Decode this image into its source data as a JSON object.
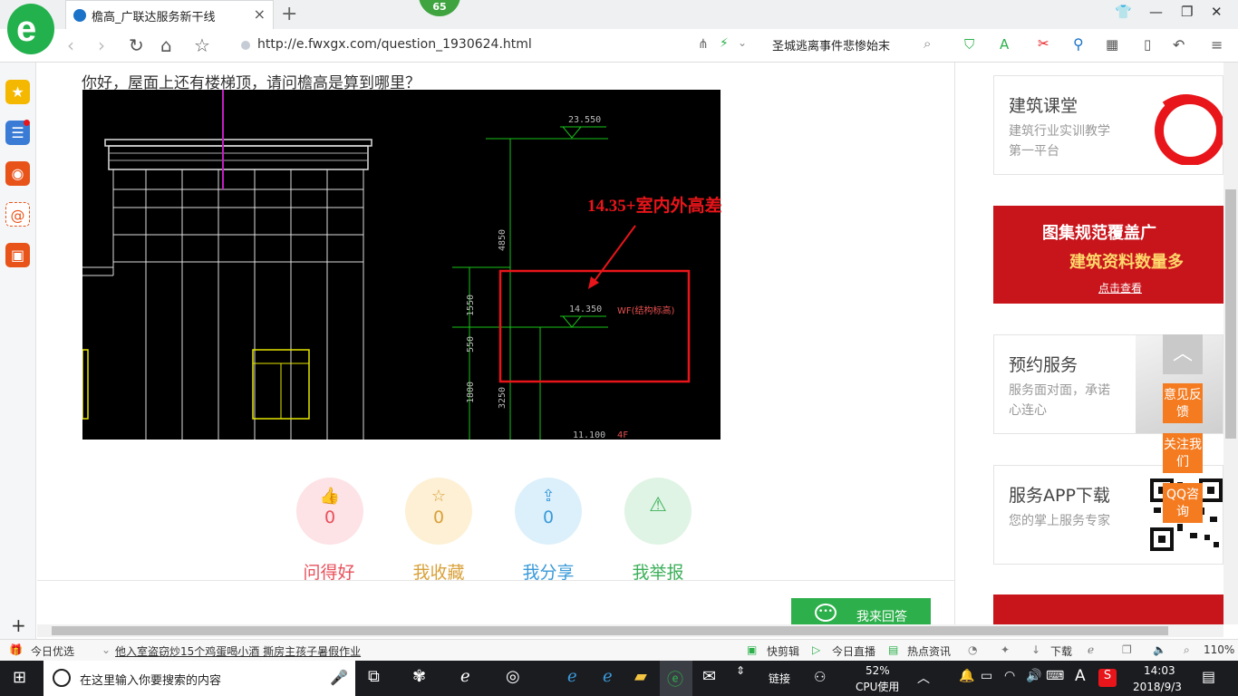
{
  "browser": {
    "tab_title": "檐高_广联达服务新干线",
    "badge_count": "65",
    "url": "http://e.fwxgx.com/question_1930624.html",
    "search_suggestion": "圣城逃离事件悲惨始末"
  },
  "question": {
    "text": "你好，屋面上还有楼梯顶，请问檐高是算到哪里？",
    "annotation": "14.35+室内外高差",
    "cad_labels": {
      "elev_top": "23.550",
      "elev_mid": "14.350",
      "elev_bottom": "11.100",
      "dim_4850": "4850",
      "dim_1550": "1550",
      "dim_550": "550",
      "dim_1800": "1800",
      "dim_3250": "3250",
      "wf_label": "WF(结构标高)",
      "floor_label": "4F"
    }
  },
  "actions": [
    {
      "label": "问得好",
      "count": "0",
      "icon": "thumbs-up-icon",
      "bg": "#fde2e6",
      "color": "#e8505b"
    },
    {
      "label": "我收藏",
      "count": "0",
      "icon": "star-icon",
      "bg": "#fdf0d4",
      "color": "#d9a13a"
    },
    {
      "label": "我分享",
      "count": "0",
      "icon": "share-icon",
      "bg": "#dcf0fb",
      "color": "#3a9ad9"
    },
    {
      "label": "我举报",
      "count": "",
      "icon": "warning-icon",
      "bg": "#dff4e4",
      "color": "#3cb05a"
    }
  ],
  "answer_button": "我来回答",
  "sidebar_cards": [
    {
      "title": "建筑课堂",
      "subtitle": "建筑行业实训教学第一平台"
    },
    {
      "title": "预约服务",
      "subtitle": "服务面对面，承诺心连心"
    },
    {
      "title": "服务APP下载",
      "subtitle": "您的掌上服务专家"
    }
  ],
  "banner": {
    "line1": "图集规范覆盖广",
    "line2": "建筑资料数量多",
    "cta": "点击查看"
  },
  "float_buttons": [
    "意见反馈",
    "关注我们",
    "QQ咨询"
  ],
  "status_bar": {
    "today": "今日优选",
    "news": "他入室盗窃炒15个鸡蛋喝小酒 撕房主孩子暑假作业",
    "items": [
      "快剪辑",
      "今日直播",
      "热点资讯",
      "下载"
    ],
    "zoom": "110%"
  },
  "taskbar": {
    "search_placeholder": "在这里输入你要搜索的内容",
    "links_label": "链接",
    "cpu_percent": "52%",
    "cpu_label": "CPU使用",
    "ime": "A",
    "time": "14:03",
    "date": "2018/9/3"
  }
}
